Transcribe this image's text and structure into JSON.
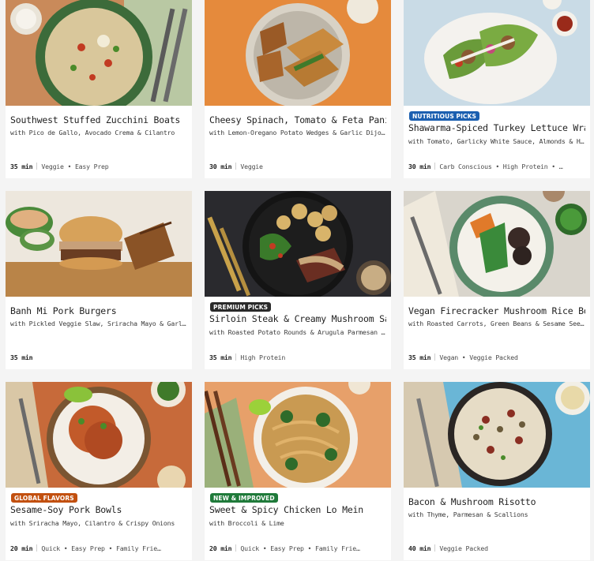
{
  "badge_colors": {
    "nutritious": "#1b5fb0",
    "premium": "#2a2a2a",
    "global": "#c2500f",
    "new": "#1f7a3a"
  },
  "recipes": [
    {
      "title": "Southwest Stuffed Zucchini Boats",
      "subtitle": "with Pico de Gallo, Avocado Crema & Cilantro",
      "time": "35 min",
      "tags": "Veggie • Easy Prep",
      "badge": "",
      "image": "zucchini-boats-photo"
    },
    {
      "title": "Cheesy Spinach, Tomato & Feta Panini",
      "subtitle": "with Lemon-Oregano Potato Wedges & Garlic Dijonn…",
      "time": "30 min",
      "tags": "Veggie",
      "badge": "",
      "image": "panini-photo"
    },
    {
      "title": "Shawarma-Spiced Turkey Lettuce Wraps",
      "subtitle": "with Tomato, Garlicky White Sauce, Almonds & Hot …",
      "time": "30 min",
      "tags": "Carb Conscious • High Protein • …",
      "badge": "NUTRITIOUS PICKS",
      "image": "lettuce-wraps-photo"
    },
    {
      "title": "Banh Mi Pork Burgers",
      "subtitle": "with Pickled Veggie Slaw, Sriracha Mayo & Garlic Po…",
      "time": "35 min",
      "tags": "",
      "badge": "",
      "image": "burger-photo"
    },
    {
      "title": "Sirloin Steak & Creamy Mushroom Sauce",
      "subtitle": "with Roasted Potato Rounds & Arugula Parmesan Sal…",
      "time": "35 min",
      "tags": "High Protein",
      "badge": "PREMIUM PICKS",
      "image": "steak-photo"
    },
    {
      "title": "Vegan Firecracker Mushroom Rice Bowls",
      "subtitle": "with Roasted Carrots, Green Beans & Sesame Seeds",
      "time": "35 min",
      "tags": "Vegan • Veggie Packed",
      "badge": "",
      "image": "rice-bowl-photo"
    },
    {
      "title": "Sesame-Soy Pork Bowls",
      "subtitle": "with Sriracha Mayo, Cilantro & Crispy Onions",
      "time": "20 min",
      "tags": "Quick • Easy Prep • Family Frie…",
      "badge": "GLOBAL FLAVORS",
      "image": "pork-bowl-photo"
    },
    {
      "title": "Sweet & Spicy Chicken Lo Mein",
      "subtitle": "with Broccoli & Lime",
      "time": "20 min",
      "tags": "Quick • Easy Prep • Family Frie…",
      "badge": "NEW & IMPROVED",
      "image": "lo-mein-photo"
    },
    {
      "title": "Bacon & Mushroom Risotto",
      "subtitle": "with Thyme, Parmesan & Scallions",
      "time": "40 min",
      "tags": "Veggie Packed",
      "badge": "",
      "image": "risotto-photo"
    }
  ]
}
